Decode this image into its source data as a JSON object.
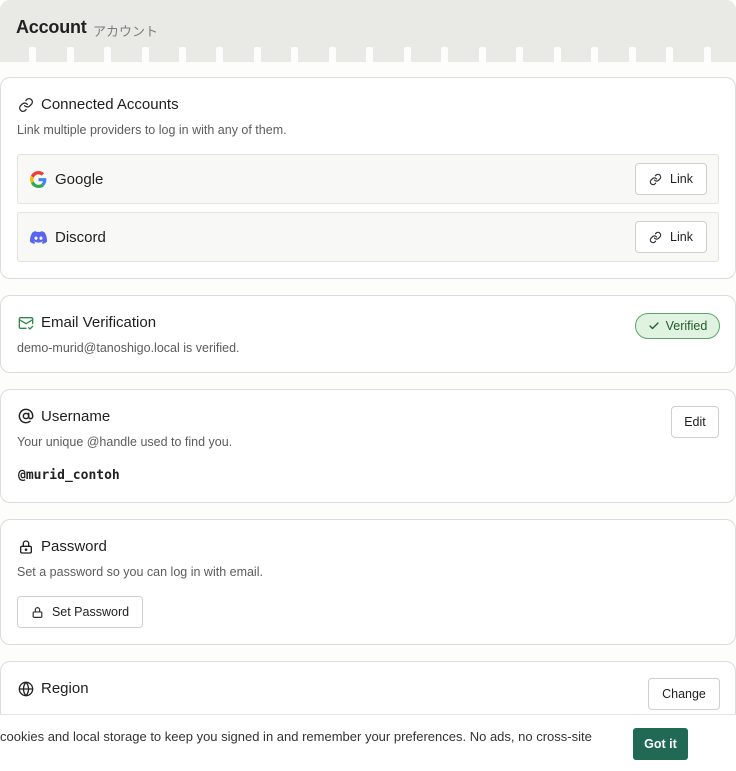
{
  "header": {
    "title": "Account",
    "subtitle": "アカウント"
  },
  "connected": {
    "title": "Connected Accounts",
    "description": "Link multiple providers to log in with any of them.",
    "providers": [
      {
        "name": "Google",
        "action": "Link"
      },
      {
        "name": "Discord",
        "action": "Link"
      }
    ]
  },
  "email": {
    "title": "Email Verification",
    "description": "demo-murid@tanoshigo.local is verified.",
    "badge": "Verified"
  },
  "username": {
    "title": "Username",
    "description": "Your unique @handle used to find you.",
    "handle": "@murid_contoh",
    "edit_label": "Edit"
  },
  "password": {
    "title": "Password",
    "description": "Set a password so you can log in with email.",
    "button_label": "Set Password"
  },
  "region": {
    "title": "Region",
    "change_label": "Change"
  },
  "cookie": {
    "text": "cookies and local storage to keep you signed in and remember your preferences. No ads, no cross-site",
    "button_label": "Got it"
  },
  "colors": {
    "accent": "#206a55",
    "verified_bg": "#dff3e0",
    "verified_border": "#5aa56a",
    "header_bg": "#e9eae5",
    "discord": "#5865f2"
  },
  "icons": [
    "link-icon",
    "google-logo",
    "discord-logo",
    "mail-check-icon",
    "check-icon",
    "at-sign-icon",
    "lock-icon",
    "globe-icon"
  ]
}
